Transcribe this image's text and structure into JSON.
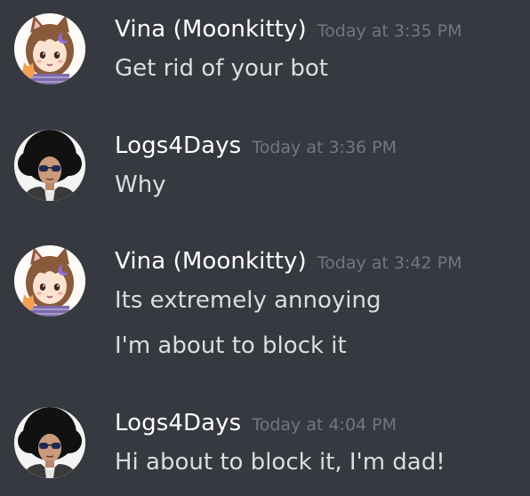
{
  "messages": [
    {
      "author": "Vina (Moonkitty)",
      "timestamp": "Today at 3:35 PM",
      "avatar_icon": "cat-girl-avatar-icon",
      "lines": [
        "Get rid of your bot"
      ]
    },
    {
      "author": "Logs4Days",
      "timestamp": "Today at 3:36 PM",
      "avatar_icon": "afro-man-avatar-icon",
      "lines": [
        "Why"
      ]
    },
    {
      "author": "Vina (Moonkitty)",
      "timestamp": "Today at 3:42 PM",
      "avatar_icon": "cat-girl-avatar-icon",
      "lines": [
        "Its extremely annoying",
        "I'm about to block it"
      ]
    },
    {
      "author": "Logs4Days",
      "timestamp": "Today at 4:04 PM",
      "avatar_icon": "afro-man-avatar-icon",
      "lines": [
        "Hi about to block it, I'm dad!"
      ]
    }
  ],
  "colors": {
    "background": "#36393f",
    "username": "#ffffff",
    "timestamp": "#72767d",
    "message_text": "#dcddde"
  }
}
